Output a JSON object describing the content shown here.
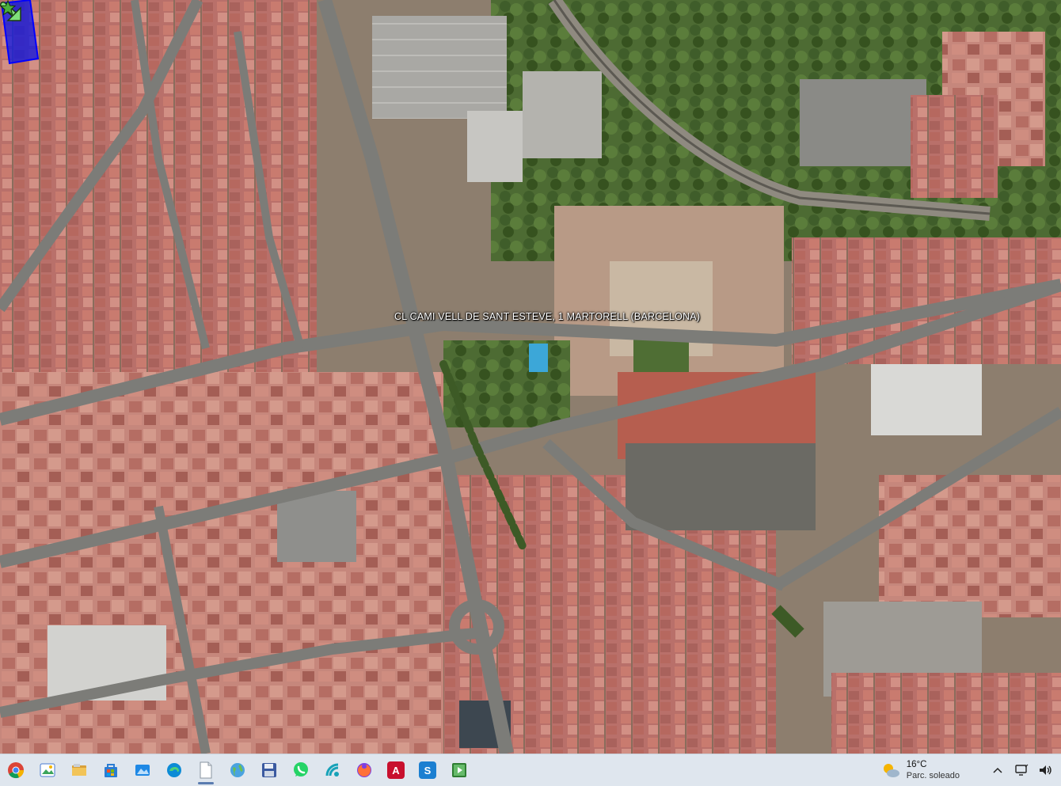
{
  "map": {
    "address_label": "CL CAMI VELL DE SANT ESTEVE, 1  MARTORELL (BARCELONA)",
    "marker_color": "#0a14e6",
    "arrow_color": "#7fe07a"
  },
  "taskbar": {
    "apps": [
      {
        "name": "chrome-icon",
        "label": ""
      },
      {
        "name": "photos-icon",
        "label": ""
      },
      {
        "name": "file-explorer-icon",
        "label": ""
      },
      {
        "name": "store-icon",
        "label": ""
      },
      {
        "name": "image-viewer-icon",
        "label": ""
      },
      {
        "name": "edge-icon",
        "label": ""
      },
      {
        "name": "document-icon",
        "label": ""
      },
      {
        "name": "globe-icon",
        "label": ""
      },
      {
        "name": "save-icon",
        "label": ""
      },
      {
        "name": "whatsapp-icon",
        "label": ""
      },
      {
        "name": "connect-icon",
        "label": ""
      },
      {
        "name": "firefox-icon",
        "label": ""
      },
      {
        "name": "autocad-icon",
        "label": "A"
      },
      {
        "name": "s-app-icon",
        "label": "S"
      },
      {
        "name": "media-player-icon",
        "label": ""
      }
    ],
    "weather": {
      "temperature": "16°C",
      "condition": "Parc. soleado"
    }
  }
}
